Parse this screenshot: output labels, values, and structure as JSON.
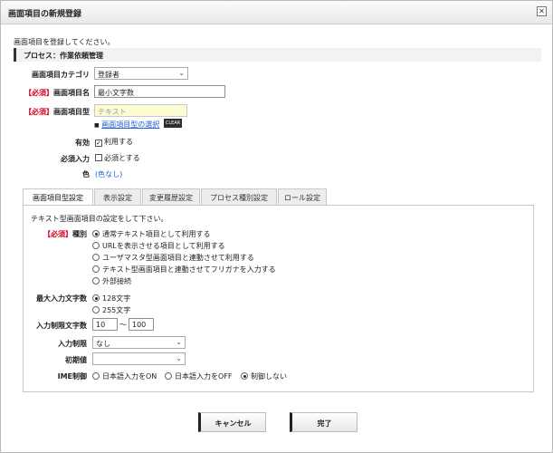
{
  "dialog": {
    "title": "画面項目の新規登録",
    "close_glyph": "✕"
  },
  "intro": "画面項目を登録してください。",
  "process": "プロセス：作業依頼管理",
  "form": {
    "category_label": "画面項目カテゴリ",
    "category_value": "登録者",
    "required": "【必須】",
    "name_label": "画面項目名",
    "name_value": "最小文字数",
    "type_label": "画面項目型",
    "type_placeholder": "テキスト",
    "type_select_link": "画面項目型の選択",
    "clear_button": "CLEAR",
    "enabled_label": "有効",
    "enabled_option": "利用する",
    "enabled_checked": true,
    "mandatory_label": "必須入力",
    "mandatory_option": "必須とする",
    "mandatory_checked": false,
    "color_label": "色",
    "color_value": "(色なし)"
  },
  "tabs": [
    {
      "label": "画面項目型設定",
      "active": true
    },
    {
      "label": "表示設定",
      "active": false
    },
    {
      "label": "変更履歴設定",
      "active": false
    },
    {
      "label": "プロセス種別設定",
      "active": false
    },
    {
      "label": "ロール設定",
      "active": false
    }
  ],
  "panel": {
    "description": "テキスト型画面項目の設定をして下さい。",
    "kind_label": "種別",
    "kind_options": [
      {
        "label": "通常テキスト項目として利用する",
        "selected": true
      },
      {
        "label": "URLを表示させる項目として利用する",
        "selected": false
      },
      {
        "label": "ユーザマスタ型画面項目と連動させて利用する",
        "selected": false
      },
      {
        "label": "テキスト型画面項目と連動させてフリガナを入力する",
        "selected": false
      },
      {
        "label": "外部接続",
        "selected": false
      }
    ],
    "maxlen_label": "最大入力文字数",
    "maxlen_options": [
      {
        "label": "128文字",
        "selected": true
      },
      {
        "label": "255文字",
        "selected": false
      }
    ],
    "range_label": "入力制限文字数",
    "range_min": "10",
    "range_sep": "～",
    "range_max": "100",
    "restrict_label": "入力制限",
    "restrict_value": "なし",
    "initial_label": "初期値",
    "initial_value": "",
    "ime_label": "IME制御",
    "ime_options": [
      {
        "label": "日本語入力をON",
        "selected": false
      },
      {
        "label": "日本語入力をOFF",
        "selected": false
      },
      {
        "label": "制御しない",
        "selected": true
      }
    ]
  },
  "buttons": {
    "cancel": "キャンセル",
    "done": "完了"
  }
}
